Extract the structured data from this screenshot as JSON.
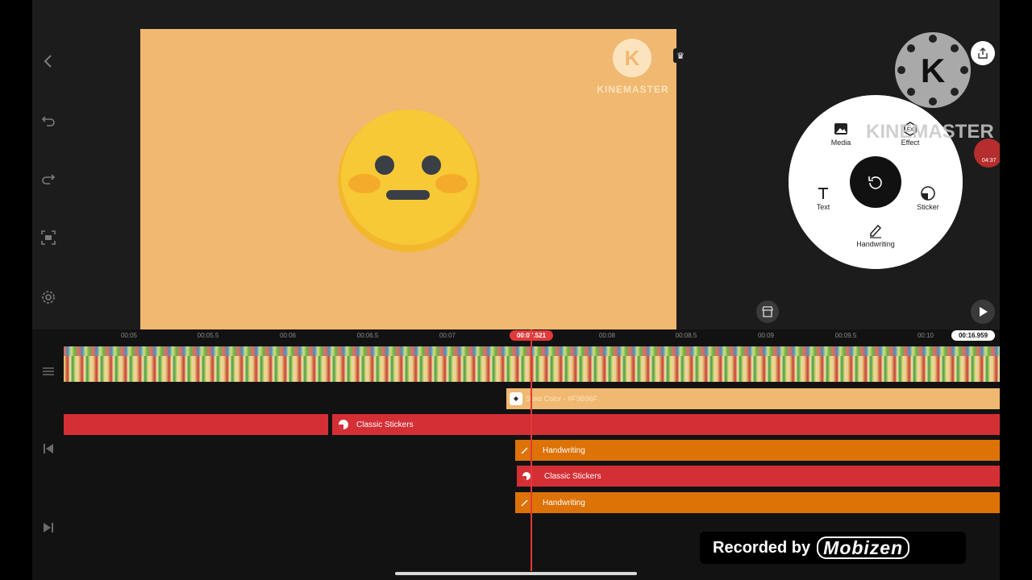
{
  "preview": {
    "watermark_logo_letter": "K",
    "watermark_text": "KINEMASTER"
  },
  "overlay": {
    "app_logo_letter": "K",
    "app_name_text": "KINEMASTER",
    "recording_time": "04:37"
  },
  "wheel_menu": {
    "items": {
      "media": "Media",
      "effect": "Effect",
      "text": "Text",
      "sticker": "Sticker",
      "handwriting": "Handwriting"
    }
  },
  "timeline": {
    "ticks": [
      "00:05",
      "00:05.5",
      "00:06",
      "00:06.5",
      "00:07",
      "00:08",
      "00:08.5",
      "00:09",
      "00:09.5",
      "00:10"
    ],
    "playhead_time": "00:07.521",
    "total_duration": "00:16.959",
    "layers": {
      "solid_color": "Solid Color - #F9B96F",
      "classic_stickers_1": "Classic Stickers",
      "handwriting_1": "Handwriting",
      "classic_stickers_2": "Classic Stickers",
      "handwriting_2": "Handwriting"
    }
  },
  "recorder": {
    "label": "Recorded by",
    "brand": "Mobizen"
  },
  "colors": {
    "preview_background": "#F0B870",
    "solid_color_clip": "#F9B96F",
    "sticker_clip": "#D52F36",
    "handwriting_clip": "#DD7207",
    "playhead": "#E03A3A"
  }
}
